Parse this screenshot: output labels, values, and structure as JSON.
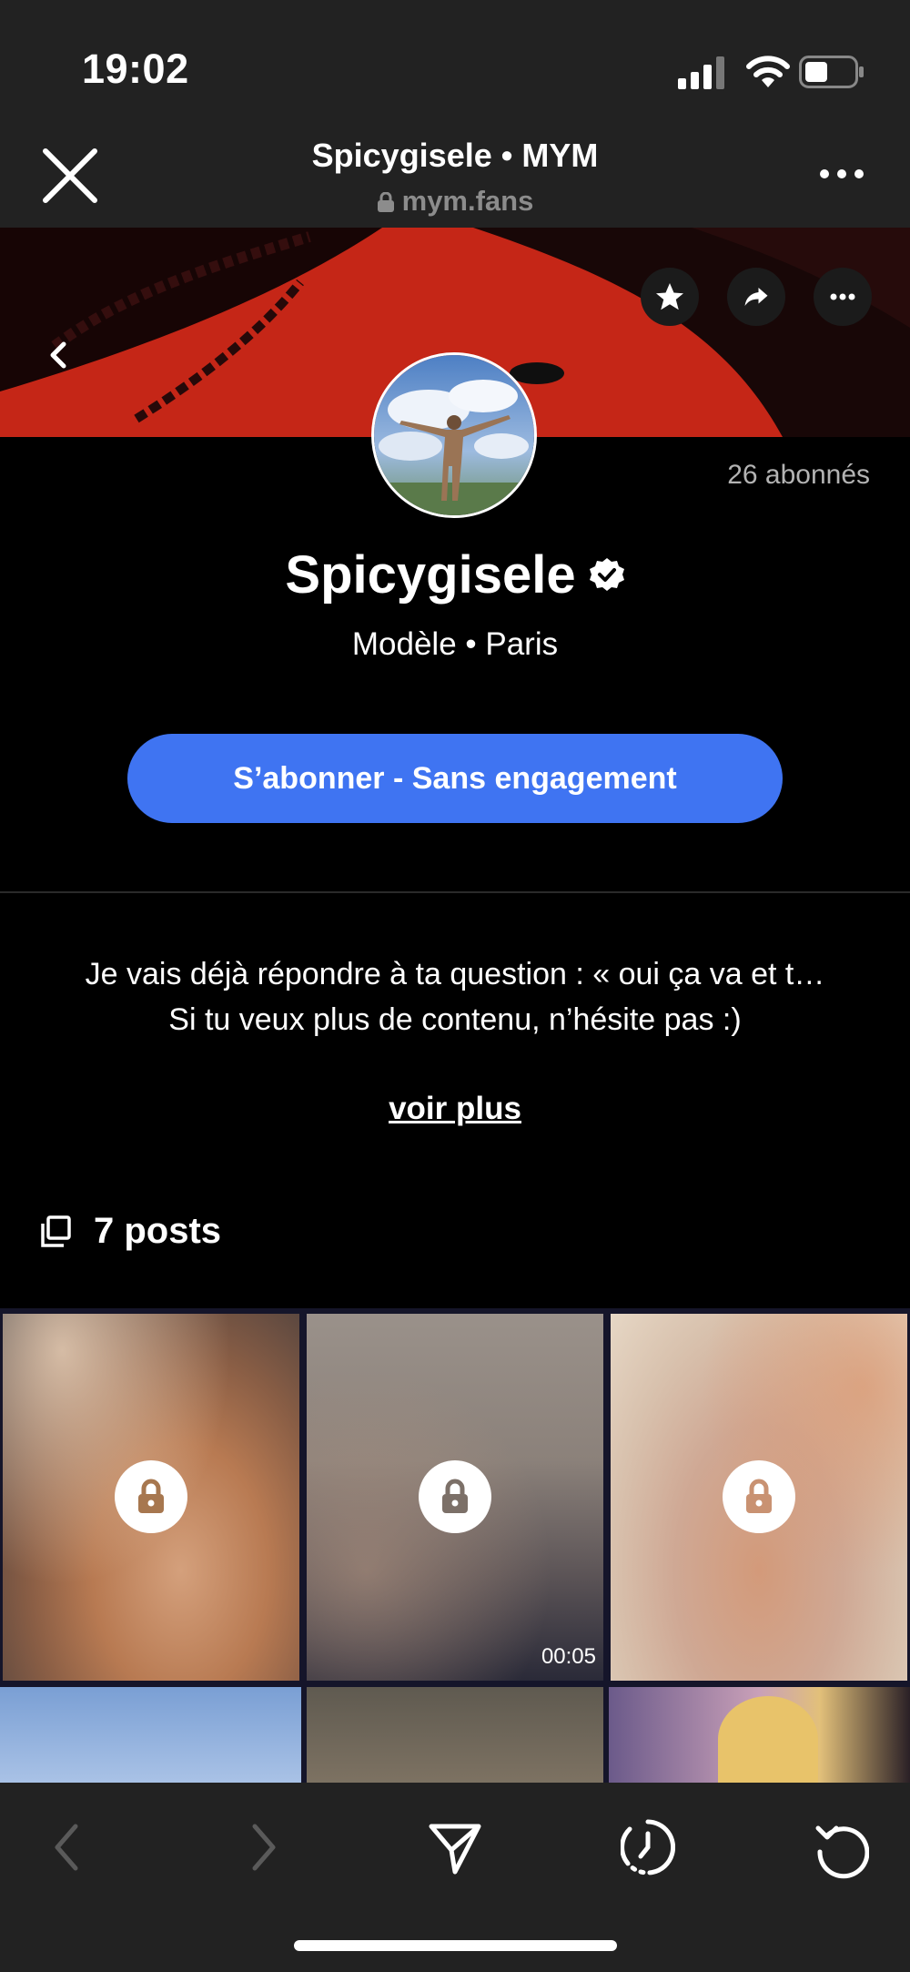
{
  "status_bar": {
    "time": "19:02"
  },
  "browser": {
    "title": "Spicygisele • MYM",
    "url": "mym.fans"
  },
  "profile": {
    "followers": "26 abonnés",
    "name": "Spicygisele",
    "subtitle": "Modèle • Paris",
    "subscribe_label": "S’abonner - Sans engagement",
    "bio_line1": "Je vais déjà répondre à ta question : « oui ça va et t…",
    "bio_line2": "Si tu veux plus de contenu, n’hésite pas :)",
    "read_more": "voir plus",
    "posts_count": "7 posts"
  },
  "grid": {
    "video_duration": "00:05"
  },
  "colors": {
    "accent": "#3f74f2",
    "banner": "#d62a1a",
    "chrome": "#222222"
  }
}
